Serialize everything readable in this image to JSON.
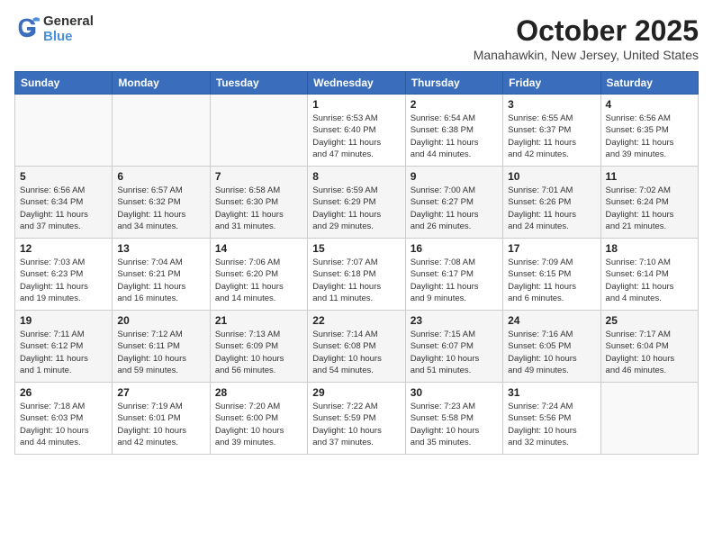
{
  "header": {
    "logo_general": "General",
    "logo_blue": "Blue",
    "month": "October 2025",
    "location": "Manahawkin, New Jersey, United States"
  },
  "calendar": {
    "days_of_week": [
      "Sunday",
      "Monday",
      "Tuesday",
      "Wednesday",
      "Thursday",
      "Friday",
      "Saturday"
    ],
    "weeks": [
      [
        {
          "day": "",
          "info": ""
        },
        {
          "day": "",
          "info": ""
        },
        {
          "day": "",
          "info": ""
        },
        {
          "day": "1",
          "info": "Sunrise: 6:53 AM\nSunset: 6:40 PM\nDaylight: 11 hours\nand 47 minutes."
        },
        {
          "day": "2",
          "info": "Sunrise: 6:54 AM\nSunset: 6:38 PM\nDaylight: 11 hours\nand 44 minutes."
        },
        {
          "day": "3",
          "info": "Sunrise: 6:55 AM\nSunset: 6:37 PM\nDaylight: 11 hours\nand 42 minutes."
        },
        {
          "day": "4",
          "info": "Sunrise: 6:56 AM\nSunset: 6:35 PM\nDaylight: 11 hours\nand 39 minutes."
        }
      ],
      [
        {
          "day": "5",
          "info": "Sunrise: 6:56 AM\nSunset: 6:34 PM\nDaylight: 11 hours\nand 37 minutes."
        },
        {
          "day": "6",
          "info": "Sunrise: 6:57 AM\nSunset: 6:32 PM\nDaylight: 11 hours\nand 34 minutes."
        },
        {
          "day": "7",
          "info": "Sunrise: 6:58 AM\nSunset: 6:30 PM\nDaylight: 11 hours\nand 31 minutes."
        },
        {
          "day": "8",
          "info": "Sunrise: 6:59 AM\nSunset: 6:29 PM\nDaylight: 11 hours\nand 29 minutes."
        },
        {
          "day": "9",
          "info": "Sunrise: 7:00 AM\nSunset: 6:27 PM\nDaylight: 11 hours\nand 26 minutes."
        },
        {
          "day": "10",
          "info": "Sunrise: 7:01 AM\nSunset: 6:26 PM\nDaylight: 11 hours\nand 24 minutes."
        },
        {
          "day": "11",
          "info": "Sunrise: 7:02 AM\nSunset: 6:24 PM\nDaylight: 11 hours\nand 21 minutes."
        }
      ],
      [
        {
          "day": "12",
          "info": "Sunrise: 7:03 AM\nSunset: 6:23 PM\nDaylight: 11 hours\nand 19 minutes."
        },
        {
          "day": "13",
          "info": "Sunrise: 7:04 AM\nSunset: 6:21 PM\nDaylight: 11 hours\nand 16 minutes."
        },
        {
          "day": "14",
          "info": "Sunrise: 7:06 AM\nSunset: 6:20 PM\nDaylight: 11 hours\nand 14 minutes."
        },
        {
          "day": "15",
          "info": "Sunrise: 7:07 AM\nSunset: 6:18 PM\nDaylight: 11 hours\nand 11 minutes."
        },
        {
          "day": "16",
          "info": "Sunrise: 7:08 AM\nSunset: 6:17 PM\nDaylight: 11 hours\nand 9 minutes."
        },
        {
          "day": "17",
          "info": "Sunrise: 7:09 AM\nSunset: 6:15 PM\nDaylight: 11 hours\nand 6 minutes."
        },
        {
          "day": "18",
          "info": "Sunrise: 7:10 AM\nSunset: 6:14 PM\nDaylight: 11 hours\nand 4 minutes."
        }
      ],
      [
        {
          "day": "19",
          "info": "Sunrise: 7:11 AM\nSunset: 6:12 PM\nDaylight: 11 hours\nand 1 minute."
        },
        {
          "day": "20",
          "info": "Sunrise: 7:12 AM\nSunset: 6:11 PM\nDaylight: 10 hours\nand 59 minutes."
        },
        {
          "day": "21",
          "info": "Sunrise: 7:13 AM\nSunset: 6:09 PM\nDaylight: 10 hours\nand 56 minutes."
        },
        {
          "day": "22",
          "info": "Sunrise: 7:14 AM\nSunset: 6:08 PM\nDaylight: 10 hours\nand 54 minutes."
        },
        {
          "day": "23",
          "info": "Sunrise: 7:15 AM\nSunset: 6:07 PM\nDaylight: 10 hours\nand 51 minutes."
        },
        {
          "day": "24",
          "info": "Sunrise: 7:16 AM\nSunset: 6:05 PM\nDaylight: 10 hours\nand 49 minutes."
        },
        {
          "day": "25",
          "info": "Sunrise: 7:17 AM\nSunset: 6:04 PM\nDaylight: 10 hours\nand 46 minutes."
        }
      ],
      [
        {
          "day": "26",
          "info": "Sunrise: 7:18 AM\nSunset: 6:03 PM\nDaylight: 10 hours\nand 44 minutes."
        },
        {
          "day": "27",
          "info": "Sunrise: 7:19 AM\nSunset: 6:01 PM\nDaylight: 10 hours\nand 42 minutes."
        },
        {
          "day": "28",
          "info": "Sunrise: 7:20 AM\nSunset: 6:00 PM\nDaylight: 10 hours\nand 39 minutes."
        },
        {
          "day": "29",
          "info": "Sunrise: 7:22 AM\nSunset: 5:59 PM\nDaylight: 10 hours\nand 37 minutes."
        },
        {
          "day": "30",
          "info": "Sunrise: 7:23 AM\nSunset: 5:58 PM\nDaylight: 10 hours\nand 35 minutes."
        },
        {
          "day": "31",
          "info": "Sunrise: 7:24 AM\nSunset: 5:56 PM\nDaylight: 10 hours\nand 32 minutes."
        },
        {
          "day": "",
          "info": ""
        }
      ]
    ]
  }
}
